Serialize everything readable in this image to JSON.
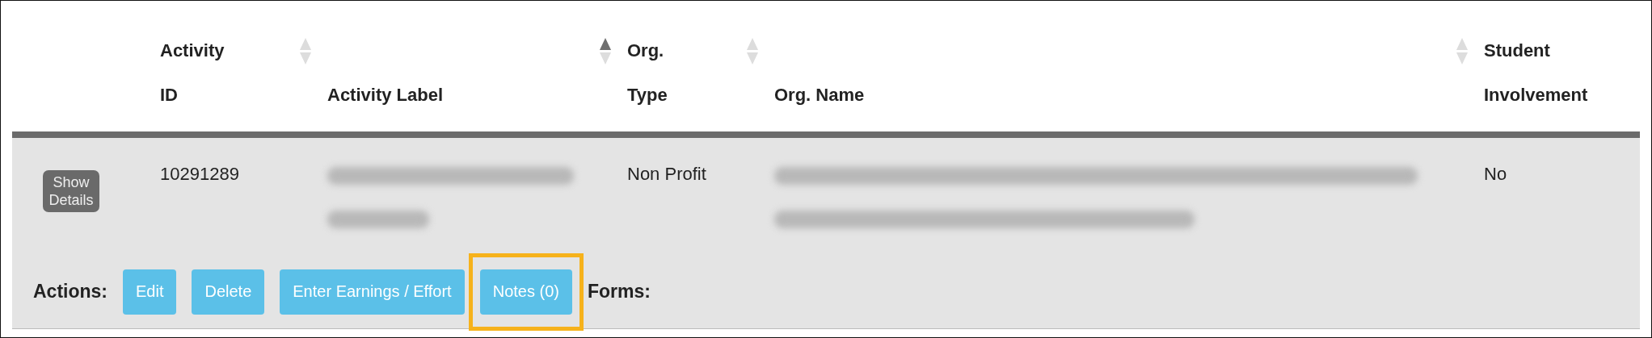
{
  "table": {
    "columns": [
      {},
      {
        "label": "Activity ID",
        "sortable": true,
        "sorted": false
      },
      {
        "label": "Activity Label",
        "sortable": true,
        "sorted": true
      },
      {
        "label": "Org. Type",
        "sortable": true,
        "sorted": false
      },
      {
        "label": "Org. Name",
        "sortable": true,
        "sorted": false
      },
      {
        "label": "Student Involvement"
      }
    ],
    "rows": [
      {
        "cells": [
          {
            "kind": "button",
            "text": "Show Details"
          },
          {
            "kind": "text",
            "text": "10291289"
          },
          {
            "kind": "blurred"
          },
          {
            "kind": "text",
            "text": "Non Profit"
          },
          {
            "kind": "blurred"
          },
          {
            "kind": "text",
            "text": "No"
          }
        ],
        "actions_label": "Actions:",
        "actions": [
          {
            "label": "Edit",
            "highlighted": false
          },
          {
            "label": "Delete",
            "highlighted": false
          },
          {
            "label": "Enter Earnings / Effort",
            "highlighted": false
          },
          {
            "label": "Notes (0)",
            "highlighted": true
          }
        ],
        "forms_label": "Forms:"
      }
    ]
  }
}
